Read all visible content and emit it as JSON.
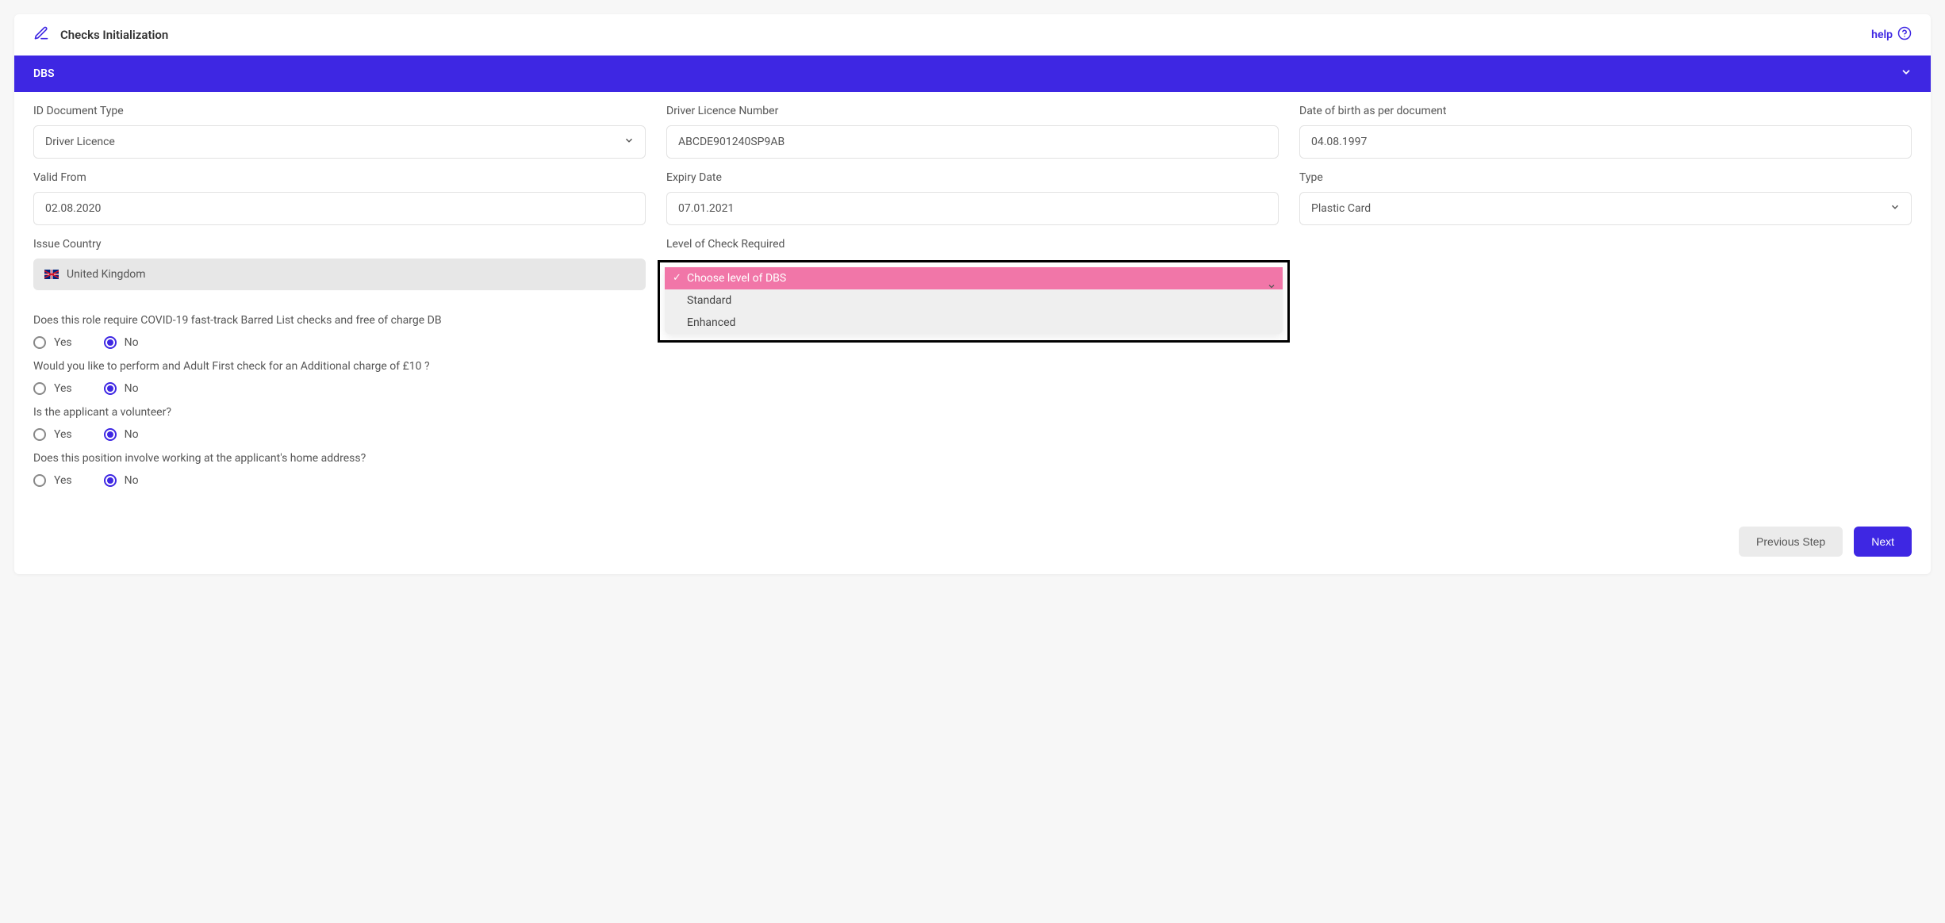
{
  "header": {
    "title": "Checks Initialization",
    "help_label": "help"
  },
  "section": {
    "title": "DBS"
  },
  "fields": {
    "id_doc_type": {
      "label": "ID Document Type",
      "value": "Driver Licence"
    },
    "licence_number": {
      "label": "Driver Licence Number",
      "value": "ABCDE901240SP9AB"
    },
    "dob": {
      "label": "Date of birth as per document",
      "value": "04.08.1997"
    },
    "valid_from": {
      "label": "Valid From",
      "value": "02.08.2020"
    },
    "expiry": {
      "label": "Expiry Date",
      "value": "07.01.2021"
    },
    "doc_type": {
      "label": "Type",
      "value": "Plastic Card"
    },
    "issue_country": {
      "label": "Issue Country",
      "value": "United Kingdom"
    },
    "level_check": {
      "label": "Level of Check Required",
      "options": [
        "Choose level of DBS",
        "Standard",
        "Enhanced"
      ],
      "selected_index": 0
    }
  },
  "questions": {
    "covid": {
      "text": "Does this role require COVID-19 fast-track Barred List checks and free of charge DB",
      "yes": "Yes",
      "no": "No"
    },
    "adult_first": {
      "text": "Would you like to perform and Adult First check for an Additional charge of £10 ?",
      "yes": "Yes",
      "no": "No"
    },
    "volunteer": {
      "text": "Is the applicant a volunteer?",
      "yes": "Yes",
      "no": "No"
    },
    "home_address": {
      "text": "Does this position involve working at the applicant's home address?",
      "yes": "Yes",
      "no": "No"
    }
  },
  "footer": {
    "prev": "Previous Step",
    "next": "Next"
  }
}
